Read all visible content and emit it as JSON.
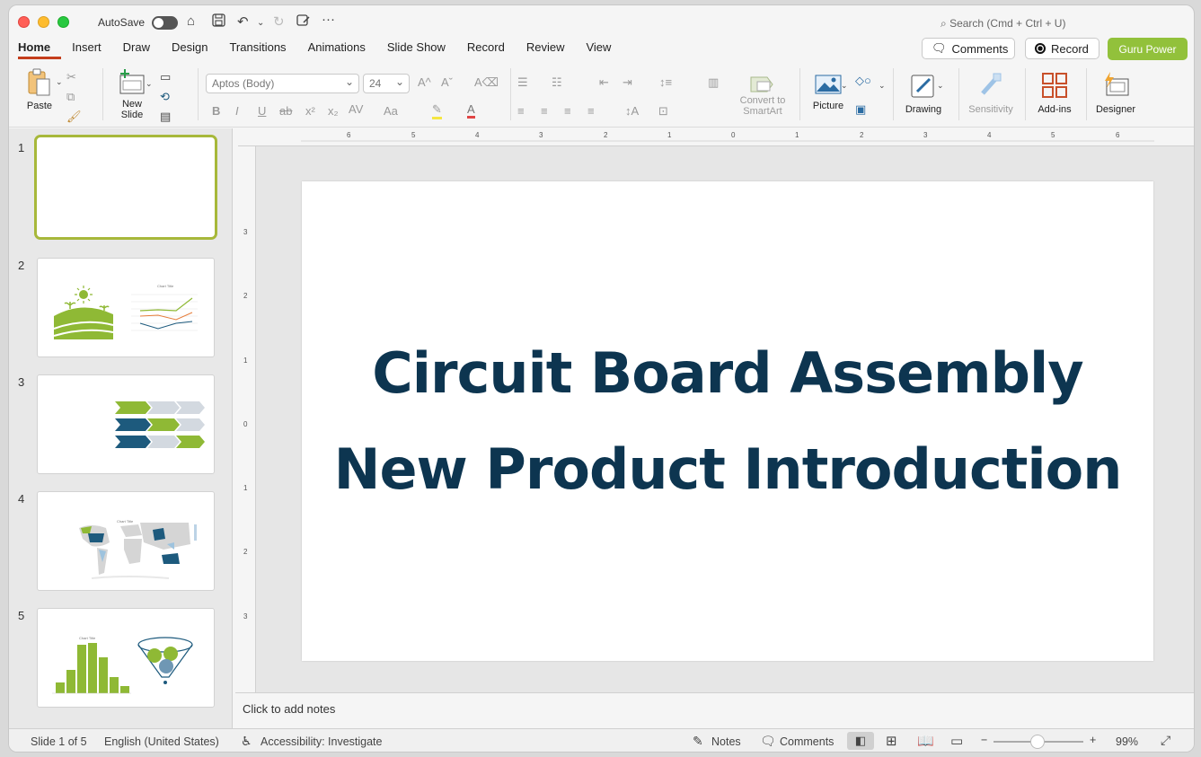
{
  "app": {
    "autosave_label": "AutoSave",
    "search_placeholder": "Search (Cmd + Ctrl + U)"
  },
  "tabs": [
    "Home",
    "Insert",
    "Draw",
    "Design",
    "Transitions",
    "Animations",
    "Slide Show",
    "Record",
    "Review",
    "View"
  ],
  "active_tab": "Home",
  "top_right": {
    "comments_label": "Comments",
    "record_label": "Record",
    "guru_label": "Guru Power"
  },
  "ribbon": {
    "paste_label": "Paste",
    "new_slide_line1": "New",
    "new_slide_line2": "Slide",
    "font_name": "Aptos (Body)",
    "font_size": "24",
    "convert_line1": "Convert to",
    "convert_line2": "SmartArt",
    "picture_label": "Picture",
    "drawing_label": "Drawing",
    "sensitivity_label": "Sensitivity",
    "addins_label": "Add-ins",
    "designer_label": "Designer"
  },
  "thumbnails": {
    "numbers": [
      "1",
      "2",
      "3",
      "4",
      "5"
    ],
    "thumb2_chart_title": "Chart Title",
    "thumb4_chart_title": "Chart Title",
    "thumb5_chart_title": "Chart Title"
  },
  "slide": {
    "title": "Circuit Board Assembly New Product Introduction"
  },
  "notes_placeholder": "Click to add notes",
  "ruler": {
    "h_labels": [
      "6",
      "5",
      "4",
      "3",
      "2",
      "1",
      "0",
      "1",
      "2",
      "3",
      "4",
      "5",
      "6"
    ],
    "v_labels": [
      "3",
      "2",
      "1",
      "0",
      "1",
      "2",
      "3"
    ]
  },
  "status": {
    "slide_info": "Slide 1 of 5",
    "language": "English (United States)",
    "accessibility": "Accessibility: Investigate",
    "notes_label": "Notes",
    "comments_label": "Comments",
    "zoom_minus": "−",
    "zoom_plus": "+",
    "zoom_level": "99%"
  },
  "colors": {
    "accent_tab": "#c43e1c",
    "guru_green": "#92c13b",
    "title_navy": "#0d3550",
    "thumb_select": "#a7b83a",
    "thumb_green": "#8fb935",
    "thumb_navy": "#1d5a7d"
  }
}
